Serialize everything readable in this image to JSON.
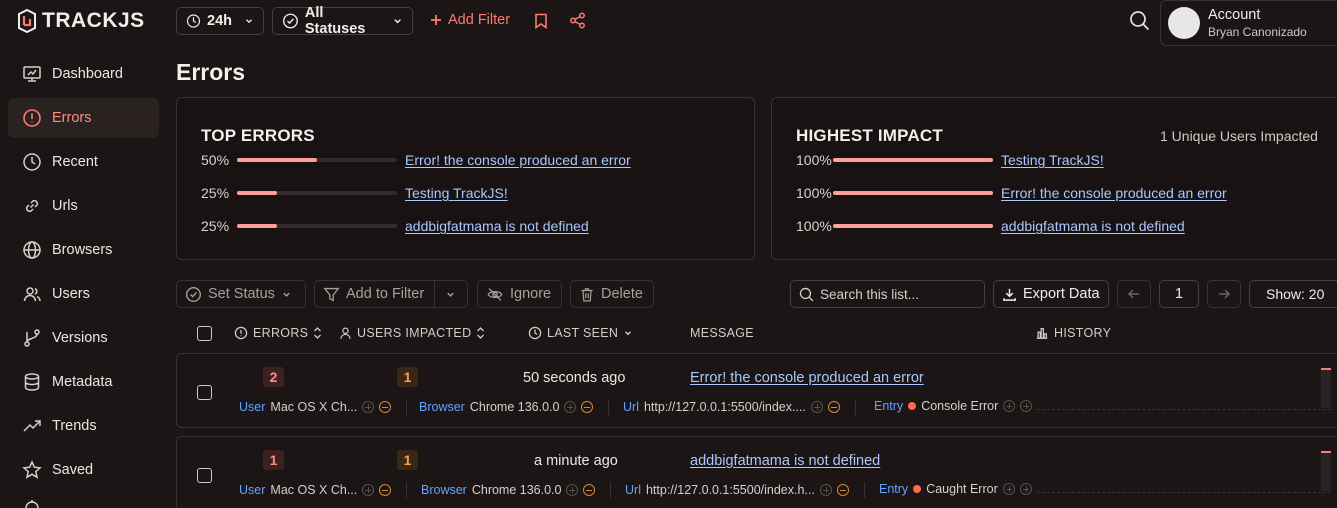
{
  "brand": {
    "name": "TRACKJS"
  },
  "sidebar": {
    "items": [
      {
        "label": "Dashboard"
      },
      {
        "label": "Errors"
      },
      {
        "label": "Recent"
      },
      {
        "label": "Urls"
      },
      {
        "label": "Browsers"
      },
      {
        "label": "Users"
      },
      {
        "label": "Versions"
      },
      {
        "label": "Metadata"
      },
      {
        "label": "Trends"
      },
      {
        "label": "Saved"
      }
    ]
  },
  "topbar": {
    "time_range": "24h",
    "status_filter": "All Statuses",
    "add_filter": "Add Filter",
    "account_title": "Account",
    "account_user": "Bryan Canonizado"
  },
  "page": {
    "title": "Errors"
  },
  "top_errors": {
    "title": "TOP ERRORS",
    "rows": [
      {
        "pct": "50%",
        "fraction": 0.5,
        "message": "Error! the console produced an error"
      },
      {
        "pct": "25%",
        "fraction": 0.25,
        "message": "Testing TrackJS!"
      },
      {
        "pct": "25%",
        "fraction": 0.25,
        "message": "addbigfatmama is not defined"
      }
    ]
  },
  "highest_impact": {
    "title": "HIGHEST IMPACT",
    "summary": "1 Unique Users Impacted",
    "rows": [
      {
        "pct": "100%",
        "fraction": 1.0,
        "message": "Testing TrackJS!"
      },
      {
        "pct": "100%",
        "fraction": 1.0,
        "message": "Error! the console produced an error"
      },
      {
        "pct": "100%",
        "fraction": 1.0,
        "message": "addbigfatmama is not defined"
      }
    ]
  },
  "toolbar": {
    "set_status": "Set Status",
    "add_to_filter": "Add to Filter",
    "ignore": "Ignore",
    "delete": "Delete",
    "search_placeholder": "Search this list...",
    "export": "Export Data",
    "page": "1",
    "show": "Show: 20"
  },
  "columns": {
    "errors": "ERRORS",
    "users": "USERS IMPACTED",
    "last_seen": "LAST SEEN",
    "message": "MESSAGE",
    "history": "HISTORY"
  },
  "rows": [
    {
      "errors": "2",
      "users": "1",
      "last_seen": "50 seconds ago",
      "message": "Error! the console produced an error",
      "user_label": "User",
      "user_value": "Mac OS X Ch...",
      "browser_label": "Browser",
      "browser_value": "Chrome 136.0.0",
      "url_label": "Url",
      "url_value": "http://127.0.0.1:5500/index....",
      "entry_label": "Entry",
      "entry_value": "Console Error"
    },
    {
      "errors": "1",
      "users": "1",
      "last_seen": "a minute ago",
      "message": "addbigfatmama is not defined",
      "user_label": "User",
      "user_value": "Mac OS X Ch...",
      "browser_label": "Browser",
      "browser_value": "Chrome 136.0.0",
      "url_label": "Url",
      "url_value": "http://127.0.0.1:5500/index.h...",
      "entry_label": "Entry",
      "entry_value": "Caught Error"
    }
  ]
}
